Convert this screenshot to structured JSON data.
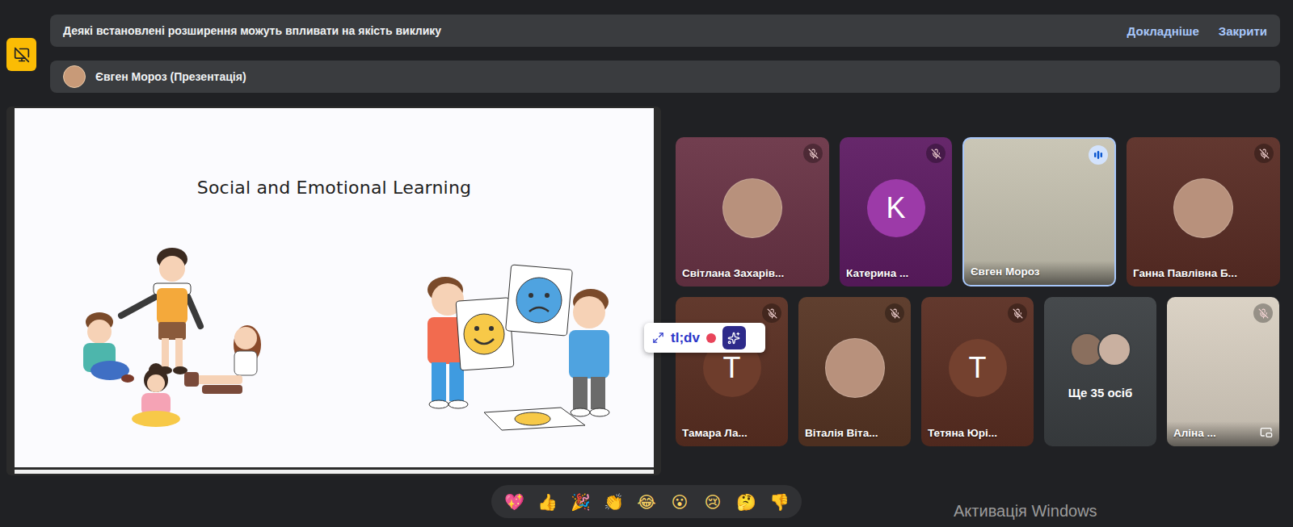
{
  "notification": {
    "text": "Деякі встановлені розширення можуть впливати на якість виклику",
    "actions": [
      "Докладніше",
      "Закрити"
    ]
  },
  "presenter_bar": {
    "text": "Євген Мороз (Презентація)"
  },
  "slide": {
    "title": "Social and Emotional Learning"
  },
  "recorder": {
    "label": "tl;dv",
    "recording": true
  },
  "participants": {
    "rows": [
      [
        {
          "kind": "photo",
          "name": "Світлана Захарів...",
          "muted": true,
          "speaking": false,
          "self": false,
          "color": "#6a3446"
        },
        {
          "kind": "letter",
          "name": "Катерина ...",
          "letter": "K",
          "muted": true,
          "speaking": false,
          "self": false,
          "color": "#5e1c63",
          "avatar_color": "#9c3aa8"
        },
        {
          "kind": "video",
          "name": "Євген Мороз",
          "muted": false,
          "speaking": true,
          "self": false,
          "color": "#c7c3b2"
        },
        {
          "kind": "photo",
          "name": "Ганна Павлівна Б...",
          "muted": true,
          "speaking": false,
          "self": false,
          "color": "#5a2d25"
        }
      ],
      [
        {
          "kind": "letter",
          "name": "Тамара Ла...",
          "letter": "T",
          "muted": true,
          "speaking": false,
          "self": false,
          "color": "#5a2f22",
          "avatar_color": "#6e3d2c"
        },
        {
          "kind": "photo",
          "name": "Віталія Віта...",
          "muted": true,
          "speaking": false,
          "self": false,
          "color": "#573524"
        },
        {
          "kind": "letter",
          "name": "Тетяна Юрі...",
          "letter": "T",
          "muted": true,
          "speaking": false,
          "self": false,
          "color": "#5a2e22",
          "avatar_color": "#74412f"
        },
        {
          "kind": "more",
          "label": "Ще 35 осіб",
          "muted": false,
          "speaking": false,
          "self": false,
          "color": "#3c4043"
        },
        {
          "kind": "video",
          "name": "Аліна ...",
          "muted": true,
          "speaking": false,
          "self": true,
          "color": "#d9d0c2"
        }
      ]
    ]
  },
  "reactions": [
    "💖",
    "👍",
    "🎉",
    "👏",
    "😂",
    "😮",
    "😢",
    "🤔",
    "👎"
  ],
  "watermark": "Активація Windows"
}
